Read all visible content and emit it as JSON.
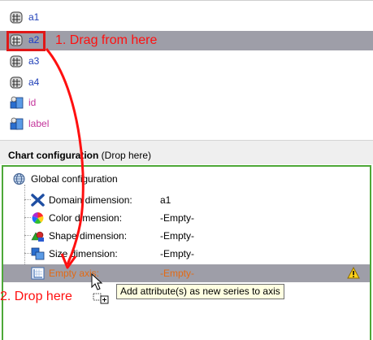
{
  "attributes": [
    {
      "label": "a1",
      "icon": "numeric-attribute-icon"
    },
    {
      "label": "a2",
      "icon": "numeric-attribute-icon"
    },
    {
      "label": "a3",
      "icon": "numeric-attribute-icon"
    },
    {
      "label": "a4",
      "icon": "numeric-attribute-icon"
    },
    {
      "label": "id",
      "icon": "special-attribute-icon"
    },
    {
      "label": "label",
      "icon": "special-attribute-icon"
    }
  ],
  "annotations": {
    "drag_label": "1. Drag from here",
    "drop_label": "2. Drop here"
  },
  "config_header": {
    "title": "Chart configuration",
    "hint": "(Drop here)"
  },
  "tree": {
    "root_label": "Global configuration",
    "rows": [
      {
        "name": "Domain dimension:",
        "value": "a1"
      },
      {
        "name": "Color dimension:",
        "value": "-Empty-"
      },
      {
        "name": "Shape dimension:",
        "value": "-Empty-"
      },
      {
        "name": "Size dimension:",
        "value": "-Empty-"
      },
      {
        "name": "Empty axis:",
        "value": "-Empty-"
      }
    ]
  },
  "tooltip": "Add attribute(s) as new series to axis",
  "colors": {
    "selection": "#9e9ea8",
    "annotation": "#ff1010",
    "panel_border": "#4da838",
    "warning": "#e36a14"
  }
}
